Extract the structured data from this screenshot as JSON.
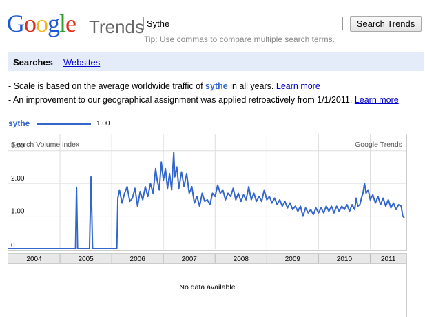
{
  "header": {
    "logo_google": "Google",
    "logo_trends": "Trends",
    "search_value": "Sythe",
    "search_button": "Search Trends",
    "tip": "Tip: Use commas to compare multiple search terms."
  },
  "tabs": {
    "active": "Searches",
    "other": "Websites"
  },
  "notes": {
    "line1_pre": "- Scale is based on the average worldwide traffic of ",
    "line1_term": "sythe",
    "line1_post": " in all years. ",
    "line2_pre": "- An improvement to our geographical assignment was applied retroactively from 1/1/2011. ",
    "learn_more": "Learn more"
  },
  "legend": {
    "name": "sythe",
    "value": "1.00"
  },
  "lower_panel": {
    "message": "No data available"
  },
  "colors": {
    "series": "#3366cc",
    "tabbar": "#e5ecf9",
    "link": "#0000cc"
  },
  "chart_data": {
    "type": "line",
    "y_axis_title": "Search Volume index",
    "watermark": "Google Trends",
    "y_ticks": [
      "0",
      "1.00",
      "2.00",
      "3.00"
    ],
    "ylim": [
      0,
      3.5
    ],
    "x_ticks": [
      "2004",
      "2005",
      "2006",
      "2007",
      "2008",
      "2009",
      "2010",
      "2011"
    ],
    "xlim": [
      2004.0,
      2011.7
    ],
    "grid": true,
    "series": [
      {
        "name": "sythe",
        "points": [
          [
            2004.0,
            0
          ],
          [
            2005.3,
            0
          ],
          [
            2005.32,
            1.88
          ],
          [
            2005.34,
            0
          ],
          [
            2005.57,
            0
          ],
          [
            2005.6,
            2.2
          ],
          [
            2005.63,
            0
          ],
          [
            2005.88,
            0
          ],
          [
            2005.92,
            0
          ],
          [
            2006.1,
            0
          ],
          [
            2006.12,
            1.55
          ],
          [
            2006.15,
            1.8
          ],
          [
            2006.2,
            1.4
          ],
          [
            2006.25,
            1.7
          ],
          [
            2006.3,
            1.9
          ],
          [
            2006.35,
            1.45
          ],
          [
            2006.4,
            1.55
          ],
          [
            2006.45,
            1.85
          ],
          [
            2006.5,
            1.3
          ],
          [
            2006.55,
            1.75
          ],
          [
            2006.6,
            1.5
          ],
          [
            2006.65,
            1.9
          ],
          [
            2006.7,
            1.6
          ],
          [
            2006.75,
            2.0
          ],
          [
            2006.8,
            1.7
          ],
          [
            2006.85,
            2.45
          ],
          [
            2006.88,
            2.1
          ],
          [
            2006.92,
            1.8
          ],
          [
            2006.96,
            2.65
          ],
          [
            2007.0,
            2.1
          ],
          [
            2007.04,
            2.45
          ],
          [
            2007.08,
            1.85
          ],
          [
            2007.12,
            2.3
          ],
          [
            2007.16,
            1.8
          ],
          [
            2007.2,
            2.95
          ],
          [
            2007.22,
            2.2
          ],
          [
            2007.26,
            2.5
          ],
          [
            2007.3,
            1.85
          ],
          [
            2007.35,
            2.35
          ],
          [
            2007.4,
            1.9
          ],
          [
            2007.45,
            2.3
          ],
          [
            2007.5,
            1.7
          ],
          [
            2007.55,
            1.9
          ],
          [
            2007.6,
            1.4
          ],
          [
            2007.65,
            1.6
          ],
          [
            2007.7,
            1.3
          ],
          [
            2007.75,
            1.7
          ],
          [
            2007.8,
            1.45
          ],
          [
            2007.85,
            1.5
          ],
          [
            2007.9,
            1.35
          ],
          [
            2007.95,
            1.7
          ],
          [
            2008.0,
            1.6
          ],
          [
            2008.05,
            1.95
          ],
          [
            2008.1,
            1.7
          ],
          [
            2008.15,
            1.8
          ],
          [
            2008.2,
            1.5
          ],
          [
            2008.25,
            1.7
          ],
          [
            2008.3,
            1.6
          ],
          [
            2008.35,
            1.85
          ],
          [
            2008.4,
            1.5
          ],
          [
            2008.45,
            1.7
          ],
          [
            2008.5,
            1.45
          ],
          [
            2008.55,
            1.65
          ],
          [
            2008.6,
            1.5
          ],
          [
            2008.65,
            1.9
          ],
          [
            2008.7,
            1.5
          ],
          [
            2008.75,
            1.7
          ],
          [
            2008.8,
            1.45
          ],
          [
            2008.85,
            1.6
          ],
          [
            2008.9,
            1.45
          ],
          [
            2008.95,
            1.8
          ],
          [
            2009.0,
            1.5
          ],
          [
            2009.05,
            1.6
          ],
          [
            2009.1,
            1.4
          ],
          [
            2009.15,
            1.55
          ],
          [
            2009.2,
            1.35
          ],
          [
            2009.25,
            1.5
          ],
          [
            2009.3,
            1.3
          ],
          [
            2009.35,
            1.45
          ],
          [
            2009.4,
            1.25
          ],
          [
            2009.45,
            1.4
          ],
          [
            2009.5,
            1.2
          ],
          [
            2009.55,
            1.3
          ],
          [
            2009.6,
            1.15
          ],
          [
            2009.65,
            1.3
          ],
          [
            2009.7,
            1.0
          ],
          [
            2009.75,
            1.25
          ],
          [
            2009.8,
            1.1
          ],
          [
            2009.85,
            1.2
          ],
          [
            2009.9,
            1.05
          ],
          [
            2009.95,
            1.25
          ],
          [
            2010.0,
            1.1
          ],
          [
            2010.05,
            1.25
          ],
          [
            2010.1,
            1.1
          ],
          [
            2010.15,
            1.3
          ],
          [
            2010.2,
            1.15
          ],
          [
            2010.25,
            1.3
          ],
          [
            2010.3,
            1.1
          ],
          [
            2010.35,
            1.3
          ],
          [
            2010.4,
            1.15
          ],
          [
            2010.45,
            1.3
          ],
          [
            2010.5,
            1.2
          ],
          [
            2010.55,
            1.35
          ],
          [
            2010.6,
            1.15
          ],
          [
            2010.65,
            1.35
          ],
          [
            2010.7,
            1.2
          ],
          [
            2010.73,
            1.55
          ],
          [
            2010.76,
            1.3
          ],
          [
            2010.8,
            1.35
          ],
          [
            2010.83,
            1.55
          ],
          [
            2010.86,
            1.7
          ],
          [
            2010.89,
            2.0
          ],
          [
            2010.92,
            1.7
          ],
          [
            2010.96,
            1.8
          ],
          [
            2011.0,
            1.5
          ],
          [
            2011.05,
            1.65
          ],
          [
            2011.1,
            1.4
          ],
          [
            2011.15,
            1.6
          ],
          [
            2011.2,
            1.35
          ],
          [
            2011.25,
            1.55
          ],
          [
            2011.3,
            1.3
          ],
          [
            2011.35,
            1.5
          ],
          [
            2011.4,
            1.25
          ],
          [
            2011.45,
            1.4
          ],
          [
            2011.5,
            1.2
          ],
          [
            2011.55,
            1.35
          ],
          [
            2011.6,
            1.3
          ],
          [
            2011.63,
            1.0
          ],
          [
            2011.66,
            0.95
          ]
        ]
      }
    ]
  }
}
